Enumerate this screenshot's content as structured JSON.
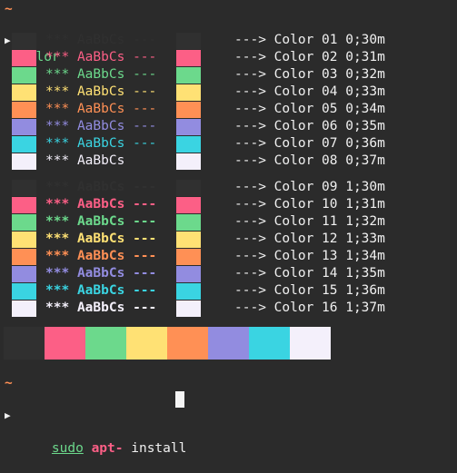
{
  "prompt": {
    "tilde": "~",
    "arrow": "▶",
    "command": "color"
  },
  "colors": {
    "c0": "#303030",
    "c1": "#fc5f86",
    "c2": "#6cd98c",
    "c3": "#ffe174",
    "c4": "#ff9055",
    "c5": "#928ce0",
    "c6": "#3ad4e2",
    "c7": "#f4f0fb",
    "prompt_cmd": "#6cd98c",
    "sudo": "#6cd98c",
    "apt": "#fc5f86"
  },
  "rows_normal": [
    {
      "stars": "***",
      "sample": "AaBbCs",
      "dashes": "---",
      "arrow": "--->",
      "label": "Color 01 0;30m"
    },
    {
      "stars": "***",
      "sample": "AaBbCs",
      "dashes": "---",
      "arrow": "--->",
      "label": "Color 02 0;31m"
    },
    {
      "stars": "***",
      "sample": "AaBbCs",
      "dashes": "---",
      "arrow": "--->",
      "label": "Color 03 0;32m"
    },
    {
      "stars": "***",
      "sample": "AaBbCs",
      "dashes": "---",
      "arrow": "--->",
      "label": "Color 04 0;33m"
    },
    {
      "stars": "***",
      "sample": "AaBbCs",
      "dashes": "---",
      "arrow": "--->",
      "label": "Color 05 0;34m"
    },
    {
      "stars": "***",
      "sample": "AaBbCs",
      "dashes": "---",
      "arrow": "--->",
      "label": "Color 06 0;35m"
    },
    {
      "stars": "***",
      "sample": "AaBbCs",
      "dashes": "---",
      "arrow": "--->",
      "label": "Color 07 0;36m"
    },
    {
      "stars": "***",
      "sample": "AaBbCs",
      "dashes": "",
      "arrow": "--->",
      "label": "Color 08 0;37m"
    }
  ],
  "rows_bold": [
    {
      "stars": "***",
      "sample": "AaBbCs",
      "dashes": "---",
      "arrow": "--->",
      "label": "Color 09 1;30m"
    },
    {
      "stars": "***",
      "sample": "AaBbCs",
      "dashes": "---",
      "arrow": "--->",
      "label": "Color 10 1;31m"
    },
    {
      "stars": "***",
      "sample": "AaBbCs",
      "dashes": "---",
      "arrow": "--->",
      "label": "Color 11 1;32m"
    },
    {
      "stars": "***",
      "sample": "AaBbCs",
      "dashes": "---",
      "arrow": "--->",
      "label": "Color 12 1;33m"
    },
    {
      "stars": "***",
      "sample": "AaBbCs",
      "dashes": "---",
      "arrow": "--->",
      "label": "Color 13 1;34m"
    },
    {
      "stars": "***",
      "sample": "AaBbCs",
      "dashes": "---",
      "arrow": "--->",
      "label": "Color 14 1;35m"
    },
    {
      "stars": "***",
      "sample": "AaBbCs",
      "dashes": "---",
      "arrow": "--->",
      "label": "Color 15 1;36m"
    },
    {
      "stars": "***",
      "sample": "AaBbCs",
      "dashes": "---",
      "arrow": "--->",
      "label": "Color 16 1;37m"
    }
  ],
  "final_prompt": {
    "tilde": "~",
    "arrow": "▶",
    "sudo": "sudo",
    "apt": "apt-",
    "install": "install"
  }
}
